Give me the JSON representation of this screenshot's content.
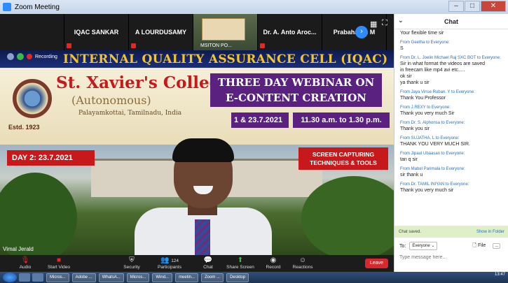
{
  "window": {
    "title": "Zoom Meeting"
  },
  "gallery": {
    "participants": [
      "IQAC SANKAR",
      "A LOURDUSAMY",
      "MSITON PO...",
      "Dr. A. Anto Aroc...",
      "Prabaharan M"
    ],
    "thumb_label": "MSITON PO..."
  },
  "recording": {
    "label": "Recording"
  },
  "share": {
    "header": "INTERNAL QUALITY ASSURANCE CELL (IQAC)",
    "college": "St. Xavier's College",
    "autonomous": "(Autonomous)",
    "place": "Palayamkottai, Tamilnadu, India",
    "estd": "Estd. 1923",
    "webinar_line1": "THREE DAY WEBINAR ON",
    "webinar_line2": "E-CONTENT CREATION",
    "dates": "1 & 23.7.2021",
    "time": "11.30 a.m. to 1.30 p.m.",
    "day": "DAY 2: 23.7.2021",
    "topic_line1": "SCREEN CAPTURING",
    "topic_line2": "TECHNIQUES & TOOLS",
    "speaker": "Vimal Jerald"
  },
  "toolbar": {
    "audio": "Audio",
    "video": "Start Video",
    "security": "Security",
    "participants": "Participants",
    "participants_count": "124",
    "chat": "Chat",
    "share": "Share Screen",
    "record": "Record",
    "reactions": "Reactions",
    "leave": "Leave"
  },
  "chat": {
    "title": "Chat",
    "messages": [
      {
        "from": "",
        "lines": [
          "Your flexible time sir"
        ]
      },
      {
        "from": "From Geetha to Everyone:",
        "lines": [
          "S"
        ]
      },
      {
        "from": "From Dr. L. Joelin Michael Raj SXC BOT to Everyone:",
        "lines": [
          "Sir in what format the videos are saved",
          "in freecam  like mp4 avi etc.....",
          "ok sir",
          "ya thank u sir"
        ]
      },
      {
        "from": "From Jaya Vinse Ruban. Y to Everyone:",
        "lines": [
          "Thank You Professor"
        ]
      },
      {
        "from": "From J.REXY to Everyone:",
        "lines": [
          "Thank you very much Sir"
        ]
      },
      {
        "from": "From Dr. S. Alphonsa to Everyone:",
        "lines": [
          "Thank you sir"
        ]
      },
      {
        "from": "From SUJATHA. L to Everyone:",
        "lines": [
          "THANK YOU VERY MUCH SIR."
        ]
      },
      {
        "from": "From Jipaul Ubaasan to Everyone:",
        "lines": [
          "tan q sir"
        ]
      },
      {
        "from": "From Mabel Parimala to Everyone:",
        "lines": [
          "sir thank u"
        ]
      },
      {
        "from": "From Dr. TAMIL INIYAN to Everyone:",
        "lines": [
          "Thank you very much sir"
        ]
      }
    ],
    "saved": "Chat saved.",
    "show_folder": "Show in Folder",
    "to_label": "To:",
    "to_value": "Everyone",
    "file_label": "File",
    "more_label": "...",
    "placeholder": "Type message here..."
  },
  "taskbar": {
    "apps": [
      "Micros...",
      "Adobe ...",
      "WhatsA...",
      "Micros...",
      "Wind...",
      "meetin...",
      "Zoom ...",
      "Desktop"
    ],
    "time": "13:47"
  }
}
